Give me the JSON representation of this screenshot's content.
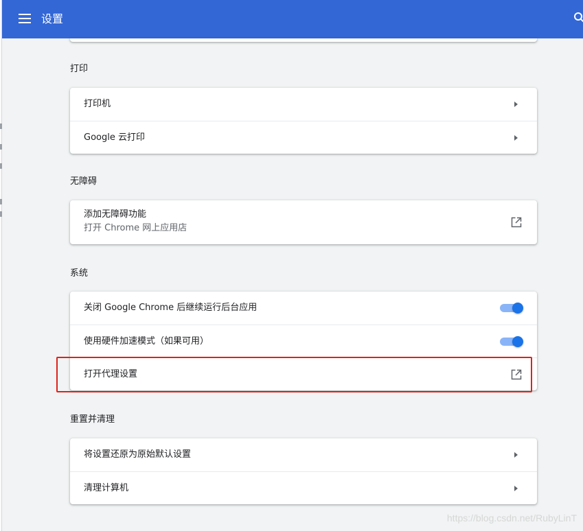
{
  "app": {
    "title": "设置"
  },
  "sections": {
    "print": {
      "title": "打印",
      "items": [
        {
          "label": "打印机"
        },
        {
          "label": "Google 云打印"
        }
      ]
    },
    "accessibility": {
      "title": "无障碍",
      "items": [
        {
          "label": "添加无障碍功能",
          "sublabel": "打开 Chrome 网上应用店"
        }
      ]
    },
    "system": {
      "title": "系统",
      "items": [
        {
          "label": "关闭 Google Chrome 后继续运行后台应用",
          "checked": true
        },
        {
          "label": "使用硬件加速模式（如果可用）",
          "checked": true
        },
        {
          "label": "打开代理设置"
        }
      ]
    },
    "reset": {
      "title": "重置并清理",
      "items": [
        {
          "label": "将设置还原为原始默认设置"
        },
        {
          "label": "清理计算机"
        }
      ]
    }
  },
  "icons": {
    "menu": "hamburger-menu-icon",
    "search": "search-icon",
    "open_external": "open-in-new-icon",
    "submenu_arrow": "arrow-right-icon"
  },
  "colors": {
    "toolbar": "#3367d6",
    "toggle_on": "#1a73e8",
    "highlight": "#e0201b"
  },
  "watermark": "https://blog.csdn.net/RubyLinT"
}
